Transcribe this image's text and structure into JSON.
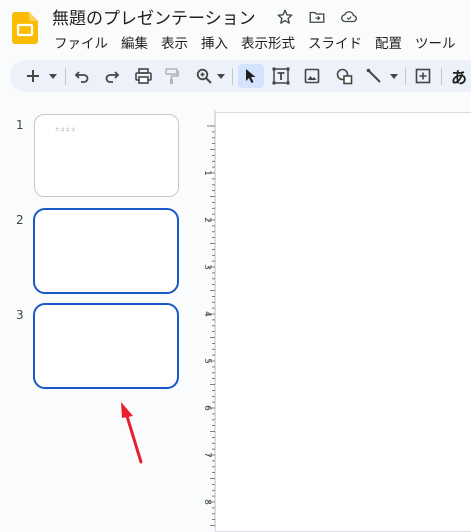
{
  "app": {
    "logo_icon": "google-slides-logo"
  },
  "document": {
    "title": "無題のプレゼンテーション"
  },
  "title_icons": [
    "star-icon",
    "move-to-folder-icon",
    "cloud-saved-icon"
  ],
  "menu": {
    "items": [
      "ファイル",
      "編集",
      "表示",
      "挿入",
      "表示形式",
      "スライド",
      "配置",
      "ツール"
    ]
  },
  "toolbar": {
    "text_tool_label": "あ",
    "buttons": [
      "new-slide",
      "new-slide-dropdown",
      "undo",
      "redo",
      "print",
      "paint-format",
      "zoom",
      "zoom-dropdown",
      "select",
      "text-box",
      "image",
      "shape",
      "line",
      "line-dropdown",
      "comment",
      "japanese-input"
    ]
  },
  "slides": [
    {
      "number": "1",
      "text": "ク  ゴ ゴ ゴ",
      "selected": false
    },
    {
      "number": "2",
      "text": "",
      "selected": true
    },
    {
      "number": "3",
      "text": "",
      "selected": true
    }
  ],
  "ruler": {
    "labels": [
      "1",
      "2",
      "3",
      "4",
      "5",
      "6",
      "7",
      "8"
    ]
  },
  "colors": {
    "accent": "#1a57c7",
    "arrow": "#e8202a",
    "toolbar_bg": "#edf2fa"
  }
}
